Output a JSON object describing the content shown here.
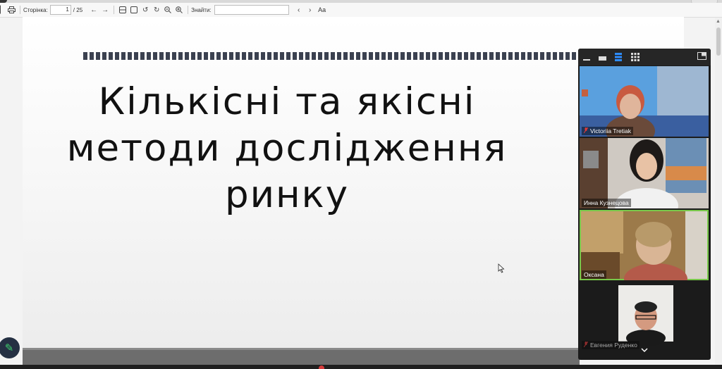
{
  "toolbar": {
    "page_label": "Сторінка:",
    "page_current": "1",
    "page_total": "/ 25",
    "find_label": "Знайти:",
    "find_placeholder": "",
    "text_size_icon": "Aa"
  },
  "slide": {
    "title_lines": [
      "Кількісні та якісні",
      "методи дослідження",
      "ринку"
    ]
  },
  "zoom": {
    "participants": [
      {
        "name": "Victoriia Tretiak",
        "muted": true
      },
      {
        "name": "Инна Кузнецова",
        "muted": false
      },
      {
        "name": "Оксана",
        "muted": false,
        "active_speaker": true
      },
      {
        "name": "Евгения Руденко",
        "muted": true
      }
    ]
  },
  "colors": {
    "slide_stripe": "#3b4150",
    "zoom_bg": "#1b1b1b",
    "active_speaker": "#78c84a",
    "fab_bg": "#253043",
    "fab_icon": "#3ed06c"
  }
}
